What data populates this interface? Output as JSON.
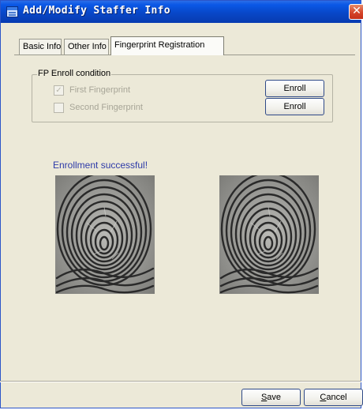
{
  "window": {
    "title": "Add/Modify Staffer Info",
    "close_glyph": "✕"
  },
  "tabs": [
    {
      "label": "Basic Info",
      "active": false
    },
    {
      "label": "Other Info",
      "active": false
    },
    {
      "label": "Fingerprint Registration",
      "active": true
    }
  ],
  "fp_enroll": {
    "legend": "FP Enroll condition",
    "first": {
      "label": "First Fingerprint",
      "checked": true,
      "enabled": false,
      "button": "Enroll"
    },
    "second": {
      "label": "Second Fingerprint",
      "checked": false,
      "enabled": false,
      "button": "Enroll"
    }
  },
  "status_message": "Enrollment successful!",
  "images": [
    "fingerprint-image",
    "fingerprint-image"
  ],
  "footer": {
    "save": {
      "mnemonic": "S",
      "rest": "ave"
    },
    "cancel": {
      "mnemonic": "C",
      "rest": "ancel"
    }
  },
  "colors": {
    "titlebar": "#0a58e6",
    "status_text": "#2d3aa8",
    "button_border": "#2f4a88"
  }
}
